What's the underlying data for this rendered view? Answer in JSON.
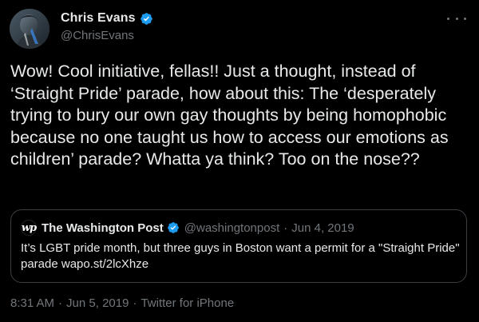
{
  "author": {
    "display_name": "Chris Evans",
    "handle": "@ChrisEvans",
    "verified": true
  },
  "tweet": {
    "text": "Wow! Cool initiative, fellas!! Just a thought, instead of ‘Straight Pride’ parade, how about this: The ‘desperately trying to bury our own gay thoughts by being homophobic because no one taught us how to access our emotions as children’ parade? Whatta ya think? Too on the nose??"
  },
  "quote": {
    "logo_text": "wp",
    "display_name": "The Washington Post",
    "verified": true,
    "handle": "@washingtonpost",
    "separator": "·",
    "date": "Jun 4, 2019",
    "text": "It’s LGBT pride month, but three guys in Boston want a permit for a \"Straight Pride\" parade wapo.st/2lcXhze"
  },
  "meta": {
    "time": "8:31 AM",
    "separator": "·",
    "date": "Jun 5, 2019",
    "source": "Twitter for iPhone"
  },
  "colors": {
    "background": "#000000",
    "primary_text": "#e7e9ea",
    "secondary_text": "#71767b",
    "verified_badge": "#1d9bf0",
    "border": "#3a3f44"
  },
  "icons": {
    "more": "more-dots-icon",
    "verified": "verified-badge-icon"
  }
}
